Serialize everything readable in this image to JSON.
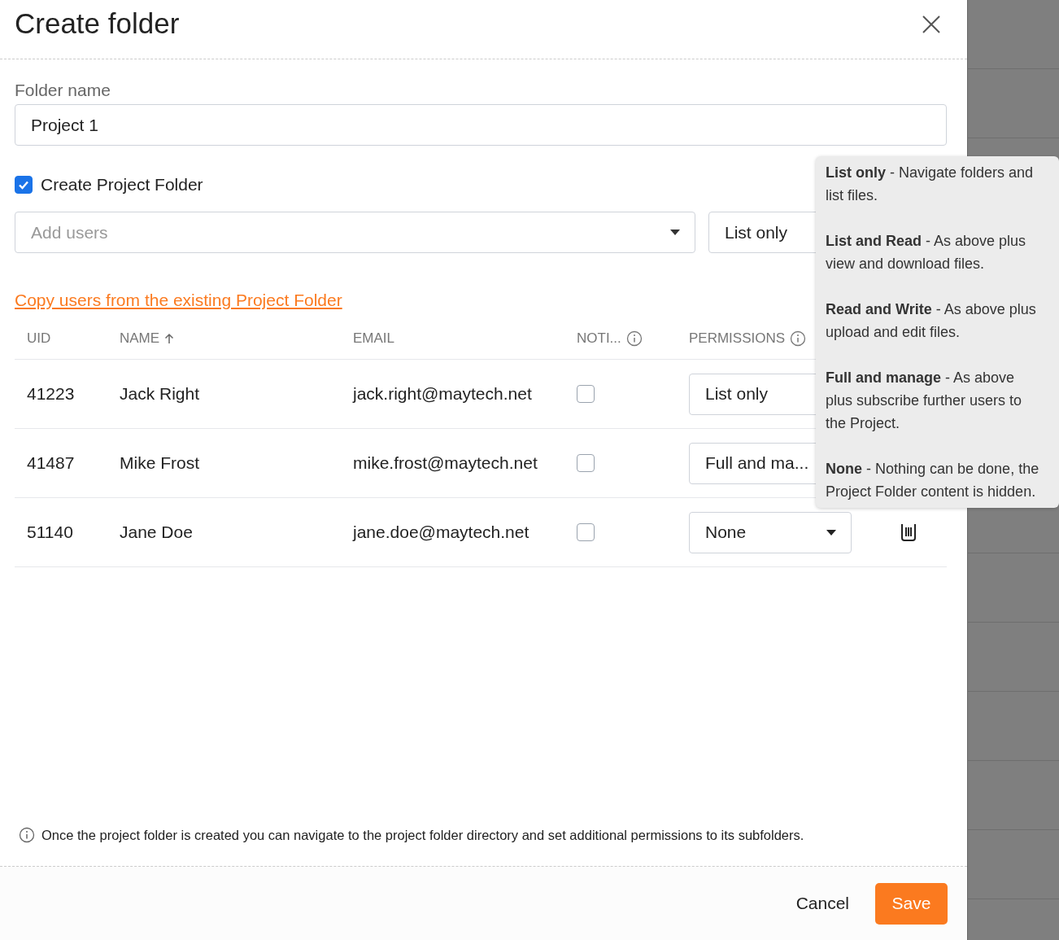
{
  "dialog": {
    "title": "Create folder"
  },
  "folder_name": {
    "label": "Folder name",
    "value": "Project 1"
  },
  "create_project_folder": {
    "label": "Create Project Folder",
    "checked": true
  },
  "add_users": {
    "placeholder": "Add users"
  },
  "default_permission": {
    "value": "List only"
  },
  "copy_link": "Copy users from the existing Project Folder",
  "table": {
    "columns": [
      {
        "label": "UID",
        "kind": "plain"
      },
      {
        "label": "NAME",
        "kind": "sorted"
      },
      {
        "label": "EMAIL",
        "kind": "plain"
      },
      {
        "label": "NOTI...",
        "kind": "help"
      },
      {
        "label": "PERMISSIONS",
        "kind": "help"
      }
    ],
    "rows": [
      {
        "uid": "41223",
        "name": "Jack Right",
        "email": "jack.right@maytech.net",
        "notify": false,
        "permission": "List only"
      },
      {
        "uid": "41487",
        "name": "Mike Frost",
        "email": "mike.frost@maytech.net",
        "notify": false,
        "permission": "Full and ma..."
      },
      {
        "uid": "51140",
        "name": "Jane Doe",
        "email": "jane.doe@maytech.net",
        "notify": false,
        "permission": "None"
      }
    ]
  },
  "note": "Once the project folder is created you can navigate to the project folder directory and set additional permissions to its subfolders.",
  "buttons": {
    "cancel": "Cancel",
    "save": "Save"
  },
  "tooltip": [
    "**List only** - Navigate folders and list files.",
    "**List and Read** - As above plus view and download files.",
    "**Read and Write** - As above plus upload and edit files.",
    "**Full and manage** - As above plus subscribe further users to the Project.",
    "**None** - Nothing can be done, the Project Folder content is hidden."
  ]
}
